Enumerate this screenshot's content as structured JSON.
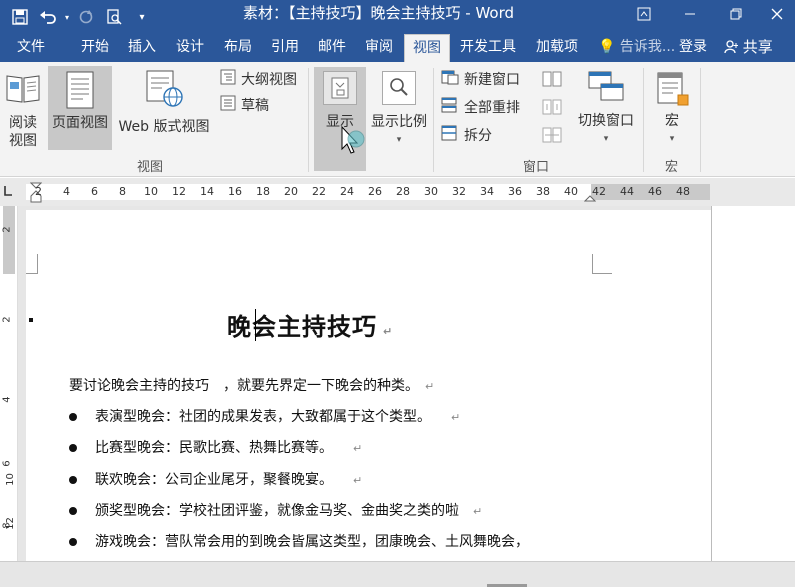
{
  "titlebar": {
    "doc_title": "素材：【主持技巧】晚会主持技巧 - Word",
    "save_icon": "save-icon",
    "undo_icon": "undo-icon",
    "redo_icon": "redo-icon",
    "preview_icon": "print-preview-icon",
    "customize_icon": "customize-qat-icon"
  },
  "tabs": [
    {
      "label": "文件"
    },
    {
      "label": "开始"
    },
    {
      "label": "插入"
    },
    {
      "label": "设计"
    },
    {
      "label": "布局"
    },
    {
      "label": "引用"
    },
    {
      "label": "邮件"
    },
    {
      "label": "审阅"
    },
    {
      "label": "视图",
      "active": true
    },
    {
      "label": "开发工具"
    },
    {
      "label": "加载项"
    }
  ],
  "tell_me": "告诉我...",
  "login": "登录",
  "share": "共享",
  "ribbon": {
    "views_group": {
      "label": "视图",
      "read_mode": "阅读\n视图",
      "read_mode_1": "阅读",
      "read_mode_2": "视图",
      "print_layout": "页面视图",
      "web_layout": "Web 版式视图",
      "outline": "大纲视图",
      "draft": "草稿"
    },
    "show_group": {
      "show": "显示"
    },
    "zoom_group": {
      "zoom": "显示比例"
    },
    "window_group": {
      "label": "窗口",
      "new_window": "新建窗口",
      "arrange_all": "全部重排",
      "split": "拆分",
      "switch_windows": "切换窗口"
    },
    "macros_group": {
      "label": "宏",
      "macros": "宏"
    }
  },
  "ruler": {
    "h_ticks": [
      "2",
      "4",
      "6",
      "8",
      "10",
      "12",
      "14",
      "16",
      "18",
      "20",
      "22",
      "24",
      "26",
      "28",
      "30",
      "32",
      "34",
      "36",
      "38",
      "40",
      "42",
      "44",
      "46",
      "48"
    ],
    "v_ticks": [
      "2",
      "2",
      "4",
      "6",
      "8",
      "10",
      "12"
    ]
  },
  "document": {
    "heading": "晚会主持技巧",
    "intro": "要讨论晚会主持的技巧　，就要先界定一下晚会的种类。",
    "bullets": [
      "表演型晚会：社团的成果发表，大致都属于这个类型。",
      "比赛型晚会：民歌比赛、热舞比赛等。",
      "联欢晚会：公司企业尾牙，聚餐晚宴。",
      "颁奖型晚会：学校社团评鉴，就像金马奖、金曲奖之类的啦",
      "游戏晚会：营队常会用的到晚会皆属这类型，团康晚会、土风舞晚会，"
    ],
    "para_mark": "↵"
  },
  "colors": {
    "brand": "#2b579a",
    "ribbon_bg": "#f3f3f3",
    "selected": "#c8c8c8"
  }
}
